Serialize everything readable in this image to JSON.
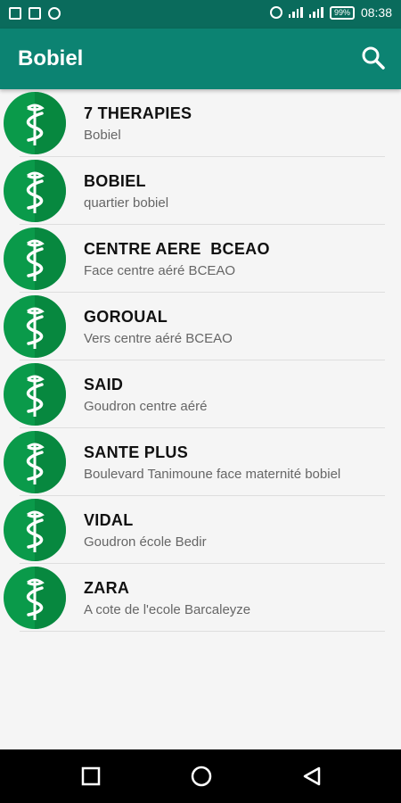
{
  "status_bar": {
    "time": "08:38",
    "battery": "99%"
  },
  "app_bar": {
    "title": "Bobiel",
    "search_icon": "search-icon"
  },
  "colors": {
    "status_bar": "#0a6b5c",
    "app_bar": "#0c8372",
    "logo_green": "#0a9a4a",
    "logo_dark": "#067a37"
  },
  "pharmacies": [
    {
      "name": "7 THERAPIES",
      "address": "Bobiel"
    },
    {
      "name": "BOBIEL",
      "address": "quartier bobiel"
    },
    {
      "name": "CENTRE AERE  BCEAO",
      "address": "Face centre aéré BCEAO"
    },
    {
      "name": "GOROUAL",
      "address": "Vers centre aéré BCEAO"
    },
    {
      "name": "SAID",
      "address": "Goudron centre aéré"
    },
    {
      "name": "SANTE PLUS",
      "address": "Boulevard Tanimoune face maternité bobiel"
    },
    {
      "name": "VIDAL",
      "address": "Goudron école Bedir"
    },
    {
      "name": "ZARA",
      "address": "A cote de l'ecole Barcaleyze"
    }
  ]
}
